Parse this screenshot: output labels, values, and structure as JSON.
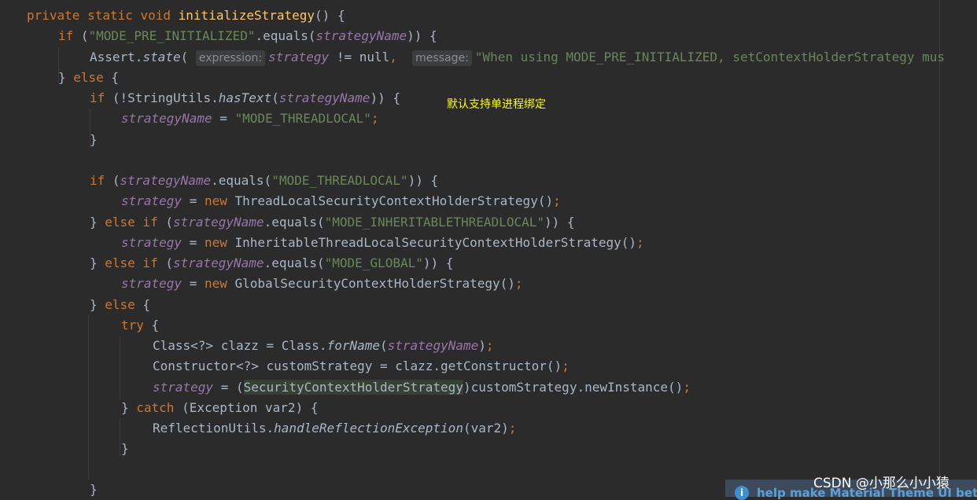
{
  "editor": {
    "annotation": "默认支持单进程绑定",
    "hints": {
      "expression": "expression:",
      "message": "message:"
    },
    "code": {
      "l1": {
        "kw": "private static void ",
        "fn": "initializeStrategy",
        "rest": "() {"
      },
      "l2": {
        "kw": "if",
        "open": " (",
        "str": "\"MODE_PRE_INITIALIZED\"",
        "mid": ".equals(",
        "fld": "strategyName",
        "close": ")) {"
      },
      "l3": {
        "a": "Assert.",
        "stat": "state",
        "b": "(",
        "fld": "strategy",
        "c": " != null",
        "comma": ",",
        "str": "\"When using MODE_PRE_INITIALIZED, setContextHolderStrategy mus"
      },
      "l4": {
        "a": "} ",
        "kw": "else",
        "b": " {"
      },
      "l5": {
        "kw": "if",
        "a": " (!StringUtils.",
        "stat": "hasText",
        "b": "(",
        "fld": "strategyName",
        "c": ")) {"
      },
      "l6": {
        "fld": "strategyName",
        "a": " = ",
        "str": "\"MODE_THREADLOCAL\"",
        "semi": ";"
      },
      "l7": {
        "a": "}"
      },
      "l9": {
        "kw": "if",
        "a": " (",
        "fld": "strategyName",
        "b": ".equals(",
        "str": "\"MODE_THREADLOCAL\"",
        "c": ")) {"
      },
      "l10": {
        "fld": "strategy",
        "a": " = ",
        "kw": "new",
        "b": " ThreadLocalSecurityContextHolderStrategy()",
        "semi": ";"
      },
      "l11": {
        "a": "} ",
        "kw": "else if",
        "b": " (",
        "fld": "strategyName",
        "c": ".equals(",
        "str": "\"MODE_INHERITABLETHREADLOCAL\"",
        "d": ")) {"
      },
      "l12": {
        "fld": "strategy",
        "a": " = ",
        "kw": "new",
        "b": " InheritableThreadLocalSecurityContextHolderStrategy()",
        "semi": ";"
      },
      "l13": {
        "a": "} ",
        "kw": "else if",
        "b": " (",
        "fld": "strategyName",
        "c": ".equals(",
        "str": "\"MODE_GLOBAL\"",
        "d": ")) {"
      },
      "l14": {
        "fld": "strategy",
        "a": " = ",
        "kw": "new",
        "b": " GlobalSecurityContextHolderStrategy()",
        "semi": ";"
      },
      "l15": {
        "a": "} ",
        "kw": "else",
        "b": " {"
      },
      "l16": {
        "kw": "try",
        "a": " {"
      },
      "l17": {
        "a": "Class<?> clazz = Class.",
        "stat": "forName",
        "b": "(",
        "fld": "strategyName",
        "c": ")",
        "semi": ";"
      },
      "l18": {
        "a": "Constructor<?> customStrategy = clazz.getConstructor()",
        "semi": ";"
      },
      "l19": {
        "fld": "strategy",
        "a": " = (",
        "cast": "SecurityContextHolderStrategy",
        "b": ")customStrategy.newInstance()",
        "semi": ";"
      },
      "l20": {
        "a": "} ",
        "kw": "catch",
        "b": " (Exception var2) {"
      },
      "l21": {
        "a": "ReflectionUtils.",
        "stat": "handleReflectionException",
        "b": "(var2)",
        "semi": ";"
      },
      "l22": {
        "a": "}"
      },
      "l24": {
        "a": "}"
      }
    }
  },
  "notification": {
    "icon": "i",
    "text": "help make Material Theme UI better"
  },
  "watermark": "CSDN @小那么小小猿"
}
